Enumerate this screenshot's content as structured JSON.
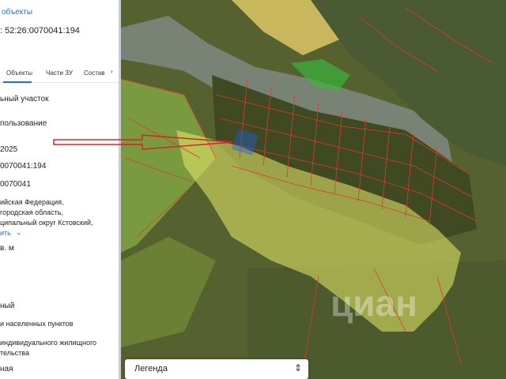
{
  "panel": {
    "top_link": "объекты",
    "cadastral_number": ": 52:26:0070041:194",
    "tabs": [
      "Объекты",
      "Части ЗУ",
      "Состав"
    ],
    "lines": [
      "ьный участок",
      "пользование",
      "2025",
      "0070041:194",
      "0070041",
      "ийская Федерация,",
      "городская область,",
      "ципальный округ Кстовский,",
      "ить",
      "в. м",
      "ный",
      "и населенных пунктов",
      "индивидуального жилищного",
      "тельства",
      "ная"
    ]
  },
  "map": {
    "watermark": "циан",
    "legend_label": "Легенда",
    "legend_icon": "chevron-updown-icon"
  },
  "colors": {
    "accent": "#1f6fd1",
    "arrow": "#d8232a",
    "parcel_highlight": "#1e5fe0",
    "zone_fill": "#e9ec6a",
    "parcel_lines": "#e03a2a"
  }
}
